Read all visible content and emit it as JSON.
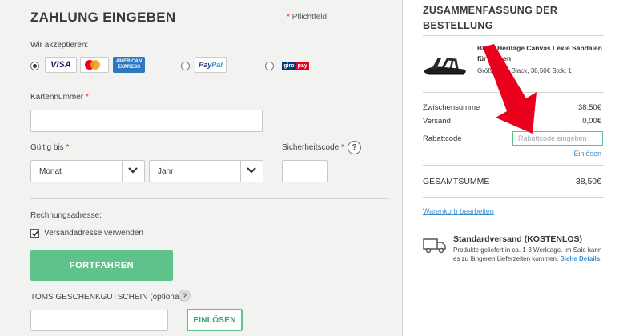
{
  "payment": {
    "title": "ZAHLUNG EINGEBEN",
    "required_note": "Pflichtfeld",
    "required_star": "*",
    "accept_label": "Wir akzeptieren:",
    "options": [
      {
        "id": "cards",
        "selected": true,
        "icons": [
          "visa-icon",
          "mastercard-icon",
          "amex-icon"
        ]
      },
      {
        "id": "paypal",
        "selected": false,
        "icons": [
          "paypal-icon"
        ]
      },
      {
        "id": "giropay",
        "selected": false,
        "icons": [
          "giropay-icon"
        ]
      }
    ],
    "card_text": {
      "visa": "VISA",
      "amex": "AMERICAN EXPRESS",
      "paypal_a": "Pay",
      "paypal_b": "Pal",
      "giro_a": "giro",
      "giro_b": "pay"
    },
    "card_number_label": "Kartennummer",
    "valid_until_label": "Gültig bis",
    "month_value": "Monat",
    "year_value": "Jahr",
    "security_code_label": "Sicherheitscode",
    "help_glyph": "?",
    "billing_label": "Rechnungsadresse:",
    "use_shipping_label": "Versandadresse verwenden",
    "use_shipping_checked": true,
    "continue_button": "FORTFAHREN",
    "gift_card_label": "TOMS GESCHENKGUTSCHEIN (optional):",
    "redeem_button": "EINLÖSEN"
  },
  "summary": {
    "title": "ZUSAMMENFASSUNG DER BESTELLUNG",
    "product_name": "Black Heritage Canvas Lexie Sandalen für Damen",
    "product_meta": "Größe: 5.5, Black, 38,50€ Stck: 1",
    "subtotal_label": "Zwischensumme",
    "subtotal_value": "38,50€",
    "shipping_label": "Versand",
    "shipping_value": "0,00€",
    "coupon_label": "Rabattcode",
    "coupon_placeholder": "Rabattcode eingeben",
    "redeem_link": "Einlösen",
    "total_label": "GESAMTSUMME",
    "total_value": "38,50€",
    "edit_cart_link": "Warenkorb bearbeiten",
    "shipping_title": "Standardversand (KOSTENLOS)",
    "shipping_text": "Produkte geliefert in ca. 1-3 Werktage. Im Sale kann es zu längeren Lieferzeiten kommen.",
    "shipping_details_link": "Siehe Details."
  },
  "colors": {
    "accent_green": "#5fc28a",
    "link_blue": "#3a8fd0",
    "required_red": "#e2232a",
    "annotation_arrow": "#e8001c"
  }
}
